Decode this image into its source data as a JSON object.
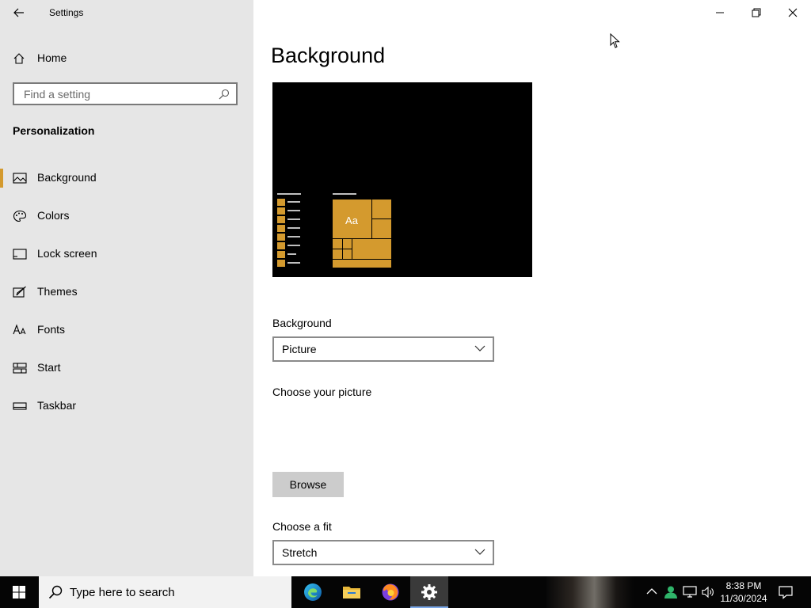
{
  "window": {
    "title": "Settings",
    "controls": {
      "minimize": "minimize",
      "restore": "restore",
      "close": "close"
    }
  },
  "sidebar": {
    "home_label": "Home",
    "search_placeholder": "Find a setting",
    "section_title": "Personalization",
    "items": [
      {
        "label": "Background",
        "icon": "picture-icon",
        "active": true
      },
      {
        "label": "Colors",
        "icon": "palette-icon",
        "active": false
      },
      {
        "label": "Lock screen",
        "icon": "lock-screen-icon",
        "active": false
      },
      {
        "label": "Themes",
        "icon": "brush-icon",
        "active": false
      },
      {
        "label": "Fonts",
        "icon": "font-icon",
        "active": false
      },
      {
        "label": "Start",
        "icon": "start-icon",
        "active": false
      },
      {
        "label": "Taskbar",
        "icon": "taskbar-icon",
        "active": false
      }
    ]
  },
  "main": {
    "page_title": "Background",
    "preview": {
      "tile_text": "Aa",
      "accent_color": "#d49a2e"
    },
    "background_label": "Background",
    "background_value": "Picture",
    "choose_picture_label": "Choose your picture",
    "browse_label": "Browse",
    "choose_fit_label": "Choose a fit",
    "fit_value": "Stretch"
  },
  "taskbar": {
    "search_text": "Type here to search",
    "apps": [
      "edge-icon",
      "file-explorer-icon",
      "firefox-icon",
      "settings-icon"
    ],
    "tray": [
      "chevron-up-icon",
      "people-icon",
      "network-icon",
      "volume-icon"
    ],
    "time": "8:38 PM",
    "date": "11/30/2024",
    "notification_icon": "notification-icon"
  },
  "colors": {
    "accent": "#d49a2e",
    "sidebar_bg": "#e6e6e6",
    "taskbar_bg": "#050505"
  }
}
